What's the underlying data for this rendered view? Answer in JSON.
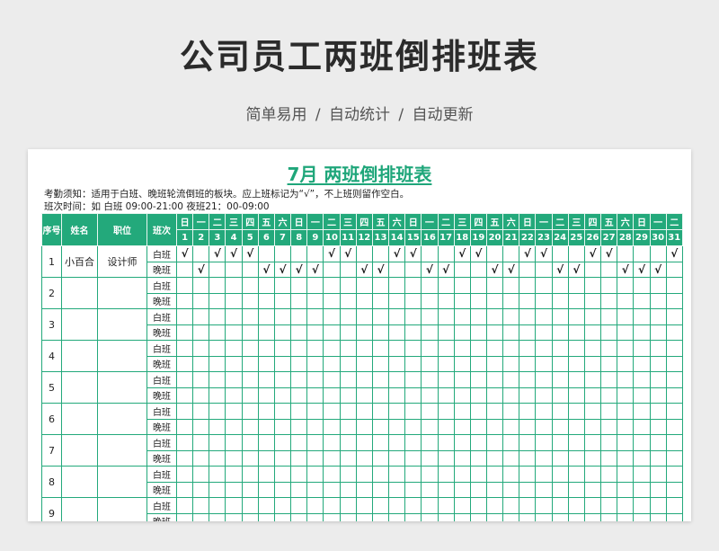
{
  "header": {
    "title": "公司员工两班倒排班表",
    "subtitle": "简单易用  /  自动统计  /  自动更新"
  },
  "sheet": {
    "title": "7月 两班倒排班表",
    "note1": "考勤须知：适用于白班、晚班轮流倒班的板块。应上班标记为“√”，不上班则留作空白。",
    "note2": "班次时间：如  白班 09:00-21:00   夜班21：00-09:00",
    "columns": {
      "seq": "序号",
      "name": "姓名",
      "position": "职位",
      "shift": "班次"
    },
    "weekdays": [
      "日",
      "一",
      "二",
      "三",
      "四",
      "五",
      "六",
      "日",
      "一",
      "二",
      "三",
      "四",
      "五",
      "六",
      "日",
      "一",
      "二",
      "三",
      "四",
      "五",
      "六",
      "日",
      "一",
      "二",
      "三",
      "四",
      "五",
      "六",
      "日",
      "一",
      "二"
    ],
    "days": [
      "1",
      "2",
      "3",
      "4",
      "5",
      "6",
      "7",
      "8",
      "9",
      "10",
      "11",
      "12",
      "13",
      "14",
      "15",
      "16",
      "17",
      "18",
      "19",
      "20",
      "21",
      "22",
      "23",
      "24",
      "25",
      "26",
      "27",
      "28",
      "29",
      "30",
      "31"
    ],
    "check_mark": "√",
    "shift_labels": [
      "白班",
      "晚班"
    ],
    "employees": [
      {
        "seq": "1",
        "name": "小百合",
        "position": "设计师",
        "day_shift_days": [
          1,
          3,
          4,
          5,
          10,
          11,
          14,
          15,
          18,
          19,
          22,
          23,
          26,
          27,
          31
        ],
        "night_shift_days": [
          2,
          6,
          7,
          8,
          9,
          12,
          13,
          16,
          17,
          20,
          21,
          24,
          25,
          28,
          29,
          30
        ]
      },
      {
        "seq": "2",
        "name": "",
        "position": "",
        "day_shift_days": [],
        "night_shift_days": []
      },
      {
        "seq": "3",
        "name": "",
        "position": "",
        "day_shift_days": [],
        "night_shift_days": []
      },
      {
        "seq": "4",
        "name": "",
        "position": "",
        "day_shift_days": [],
        "night_shift_days": []
      },
      {
        "seq": "5",
        "name": "",
        "position": "",
        "day_shift_days": [],
        "night_shift_days": []
      },
      {
        "seq": "6",
        "name": "",
        "position": "",
        "day_shift_days": [],
        "night_shift_days": []
      },
      {
        "seq": "7",
        "name": "",
        "position": "",
        "day_shift_days": [],
        "night_shift_days": []
      },
      {
        "seq": "8",
        "name": "",
        "position": "",
        "day_shift_days": [],
        "night_shift_days": []
      },
      {
        "seq": "9",
        "name": "",
        "position": "",
        "day_shift_days": [],
        "night_shift_days": []
      }
    ]
  }
}
